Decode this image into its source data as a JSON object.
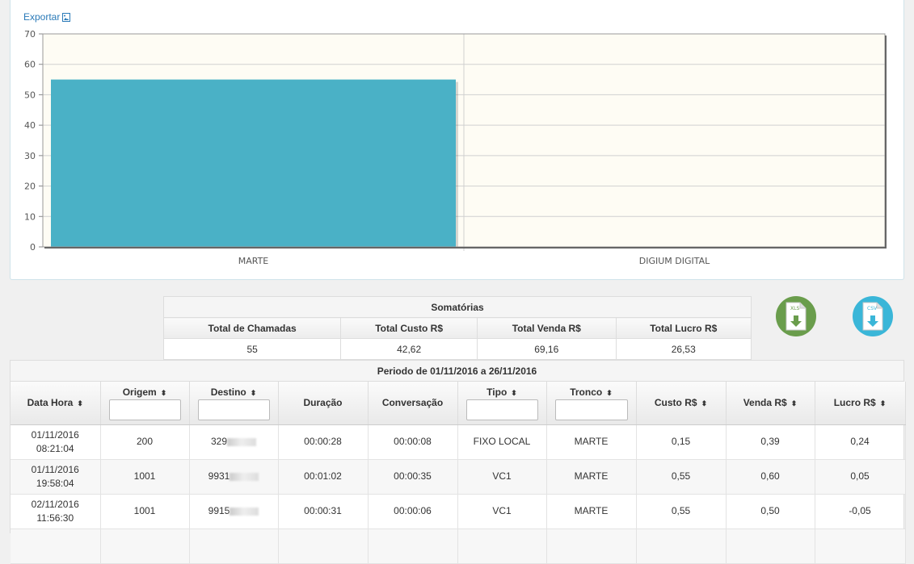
{
  "export": {
    "label": "Exportar"
  },
  "chart_data": {
    "type": "bar",
    "categories": [
      "MARTE",
      "DIGIUM DIGITAL"
    ],
    "values": [
      55,
      0
    ],
    "ylim": [
      0,
      70
    ],
    "yticks": [
      0,
      10,
      20,
      30,
      40,
      50,
      60,
      70
    ],
    "grid": true,
    "colors": {
      "bar": "#4ab1c6",
      "plot_bg": "#fefcf4"
    }
  },
  "summary": {
    "caption": "Somatórias",
    "headers": [
      "Total de Chamadas",
      "Total Custo R$",
      "Total Venda R$",
      "Total Lucro R$"
    ],
    "values": [
      "55",
      "42,62",
      "69,16",
      "26,53"
    ]
  },
  "downloads": {
    "xls_label": "XLS",
    "csv_label": "CSV",
    "xls_color": "#6a9d4c",
    "csv_color": "#3ab6d8"
  },
  "period": {
    "label": "Periodo de 01/11/2016 a 26/11/2016"
  },
  "table": {
    "headers": [
      "Data Hora",
      "Origem",
      "Destino",
      "Duração",
      "Conversação",
      "Tipo",
      "Tronco",
      "Custo R$",
      "Venda R$",
      "Lucro R$"
    ],
    "rows": [
      {
        "date": "01/11/2016",
        "time": "08:21:04",
        "origem": "200",
        "destino": "329",
        "duracao": "00:00:28",
        "conversacao": "00:00:08",
        "tipo": "FIXO LOCAL",
        "tronco": "MARTE",
        "custo": "0,15",
        "venda": "0,39",
        "lucro": "0,24"
      },
      {
        "date": "01/11/2016",
        "time": "19:58:04",
        "origem": "1001",
        "destino": "9931",
        "duracao": "00:01:02",
        "conversacao": "00:00:35",
        "tipo": "VC1",
        "tronco": "MARTE",
        "custo": "0,55",
        "venda": "0,60",
        "lucro": "0,05"
      },
      {
        "date": "02/11/2016",
        "time": "11:56:30",
        "origem": "1001",
        "destino": "9915",
        "duracao": "00:00:31",
        "conversacao": "00:00:06",
        "tipo": "VC1",
        "tronco": "MARTE",
        "custo": "0,55",
        "venda": "0,50",
        "lucro": "-0,05"
      }
    ]
  }
}
